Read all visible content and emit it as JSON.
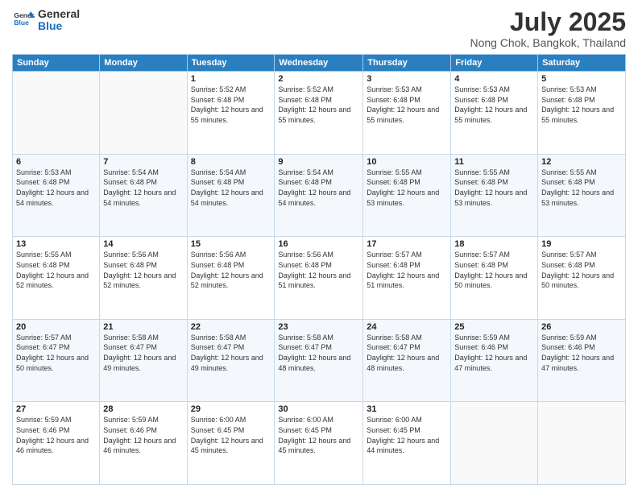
{
  "header": {
    "logo_line1": "General",
    "logo_line2": "Blue",
    "main_title": "July 2025",
    "sub_title": "Nong Chok, Bangkok, Thailand"
  },
  "calendar": {
    "days_of_week": [
      "Sunday",
      "Monday",
      "Tuesday",
      "Wednesday",
      "Thursday",
      "Friday",
      "Saturday"
    ],
    "weeks": [
      [
        {
          "day": "",
          "info": ""
        },
        {
          "day": "",
          "info": ""
        },
        {
          "day": "1",
          "info": "Sunrise: 5:52 AM\nSunset: 6:48 PM\nDaylight: 12 hours and 55 minutes."
        },
        {
          "day": "2",
          "info": "Sunrise: 5:52 AM\nSunset: 6:48 PM\nDaylight: 12 hours and 55 minutes."
        },
        {
          "day": "3",
          "info": "Sunrise: 5:53 AM\nSunset: 6:48 PM\nDaylight: 12 hours and 55 minutes."
        },
        {
          "day": "4",
          "info": "Sunrise: 5:53 AM\nSunset: 6:48 PM\nDaylight: 12 hours and 55 minutes."
        },
        {
          "day": "5",
          "info": "Sunrise: 5:53 AM\nSunset: 6:48 PM\nDaylight: 12 hours and 55 minutes."
        }
      ],
      [
        {
          "day": "6",
          "info": "Sunrise: 5:53 AM\nSunset: 6:48 PM\nDaylight: 12 hours and 54 minutes."
        },
        {
          "day": "7",
          "info": "Sunrise: 5:54 AM\nSunset: 6:48 PM\nDaylight: 12 hours and 54 minutes."
        },
        {
          "day": "8",
          "info": "Sunrise: 5:54 AM\nSunset: 6:48 PM\nDaylight: 12 hours and 54 minutes."
        },
        {
          "day": "9",
          "info": "Sunrise: 5:54 AM\nSunset: 6:48 PM\nDaylight: 12 hours and 54 minutes."
        },
        {
          "day": "10",
          "info": "Sunrise: 5:55 AM\nSunset: 6:48 PM\nDaylight: 12 hours and 53 minutes."
        },
        {
          "day": "11",
          "info": "Sunrise: 5:55 AM\nSunset: 6:48 PM\nDaylight: 12 hours and 53 minutes."
        },
        {
          "day": "12",
          "info": "Sunrise: 5:55 AM\nSunset: 6:48 PM\nDaylight: 12 hours and 53 minutes."
        }
      ],
      [
        {
          "day": "13",
          "info": "Sunrise: 5:55 AM\nSunset: 6:48 PM\nDaylight: 12 hours and 52 minutes."
        },
        {
          "day": "14",
          "info": "Sunrise: 5:56 AM\nSunset: 6:48 PM\nDaylight: 12 hours and 52 minutes."
        },
        {
          "day": "15",
          "info": "Sunrise: 5:56 AM\nSunset: 6:48 PM\nDaylight: 12 hours and 52 minutes."
        },
        {
          "day": "16",
          "info": "Sunrise: 5:56 AM\nSunset: 6:48 PM\nDaylight: 12 hours and 51 minutes."
        },
        {
          "day": "17",
          "info": "Sunrise: 5:57 AM\nSunset: 6:48 PM\nDaylight: 12 hours and 51 minutes."
        },
        {
          "day": "18",
          "info": "Sunrise: 5:57 AM\nSunset: 6:48 PM\nDaylight: 12 hours and 50 minutes."
        },
        {
          "day": "19",
          "info": "Sunrise: 5:57 AM\nSunset: 6:48 PM\nDaylight: 12 hours and 50 minutes."
        }
      ],
      [
        {
          "day": "20",
          "info": "Sunrise: 5:57 AM\nSunset: 6:47 PM\nDaylight: 12 hours and 50 minutes."
        },
        {
          "day": "21",
          "info": "Sunrise: 5:58 AM\nSunset: 6:47 PM\nDaylight: 12 hours and 49 minutes."
        },
        {
          "day": "22",
          "info": "Sunrise: 5:58 AM\nSunset: 6:47 PM\nDaylight: 12 hours and 49 minutes."
        },
        {
          "day": "23",
          "info": "Sunrise: 5:58 AM\nSunset: 6:47 PM\nDaylight: 12 hours and 48 minutes."
        },
        {
          "day": "24",
          "info": "Sunrise: 5:58 AM\nSunset: 6:47 PM\nDaylight: 12 hours and 48 minutes."
        },
        {
          "day": "25",
          "info": "Sunrise: 5:59 AM\nSunset: 6:46 PM\nDaylight: 12 hours and 47 minutes."
        },
        {
          "day": "26",
          "info": "Sunrise: 5:59 AM\nSunset: 6:46 PM\nDaylight: 12 hours and 47 minutes."
        }
      ],
      [
        {
          "day": "27",
          "info": "Sunrise: 5:59 AM\nSunset: 6:46 PM\nDaylight: 12 hours and 46 minutes."
        },
        {
          "day": "28",
          "info": "Sunrise: 5:59 AM\nSunset: 6:46 PM\nDaylight: 12 hours and 46 minutes."
        },
        {
          "day": "29",
          "info": "Sunrise: 6:00 AM\nSunset: 6:45 PM\nDaylight: 12 hours and 45 minutes."
        },
        {
          "day": "30",
          "info": "Sunrise: 6:00 AM\nSunset: 6:45 PM\nDaylight: 12 hours and 45 minutes."
        },
        {
          "day": "31",
          "info": "Sunrise: 6:00 AM\nSunset: 6:45 PM\nDaylight: 12 hours and 44 minutes."
        },
        {
          "day": "",
          "info": ""
        },
        {
          "day": "",
          "info": ""
        }
      ]
    ]
  }
}
